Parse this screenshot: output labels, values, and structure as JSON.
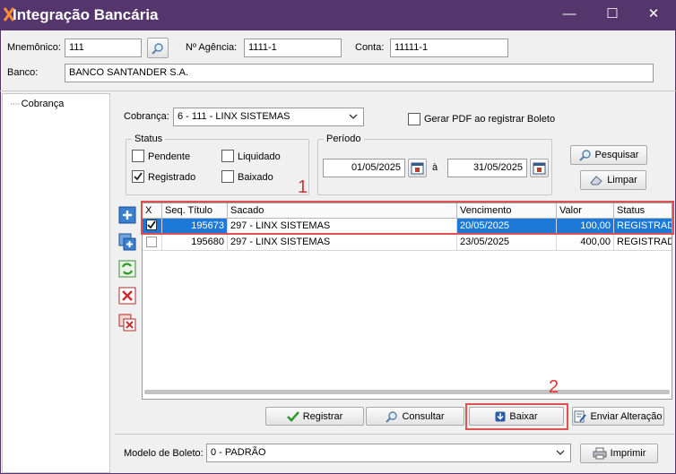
{
  "window": {
    "title": "Integração Bancária",
    "minimize_icon": "minimize-icon",
    "maximize_icon": "maximize-icon",
    "close_icon": "close-icon"
  },
  "header_fields": {
    "mnemonico_label": "Mnemônico:",
    "mnemonico_value": "111",
    "agencia_label": "Nº Agência:",
    "agencia_value": "1111-1",
    "conta_label": "Conta:",
    "conta_value": "11111-1",
    "banco_label": "Banco:",
    "banco_value": "BANCO SANTANDER S.A."
  },
  "tree": {
    "items": [
      {
        "label": "Cobrança"
      }
    ]
  },
  "filters": {
    "cobranca_label": "Cobrança:",
    "cobranca_value": "6 - 111 - LINX SISTEMAS",
    "gerar_pdf_label": "Gerar PDF ao registrar Boleto",
    "gerar_pdf_checked": false,
    "status_group_label": "Status",
    "status_options": [
      {
        "label": "Pendente",
        "checked": false
      },
      {
        "label": "Liquidado",
        "checked": false
      },
      {
        "label": "Registrado",
        "checked": true
      },
      {
        "label": "Baixado",
        "checked": false
      }
    ],
    "periodo_group_label": "Período",
    "periodo_from": "01/05/2025",
    "periodo_sep": "à",
    "periodo_to": "31/05/2025",
    "pesquisar_label": "Pesquisar",
    "limpar_label": "Limpar"
  },
  "grid": {
    "columns": [
      "X",
      "Seq. Título",
      "Sacado",
      "Vencimento",
      "Valor",
      "Status"
    ],
    "rows": [
      {
        "checked": true,
        "seq": "195673",
        "sacado": "297 - LINX SISTEMAS",
        "vencimento": "20/05/2025",
        "valor": "100,00",
        "status": "REGISTRADO",
        "selected": true
      },
      {
        "checked": false,
        "seq": "195680",
        "sacado": "297 - LINX SISTEMAS",
        "vencimento": "23/05/2025",
        "valor": "400,00",
        "status": "REGISTRADO",
        "selected": false
      }
    ]
  },
  "annotations": {
    "one": "1",
    "two": "2"
  },
  "actions": {
    "registrar": "Registrar",
    "consultar": "Consultar",
    "baixar": "Baixar",
    "enviar": "Enviar Alteração"
  },
  "footer": {
    "modelo_label": "Modelo de Boleto:",
    "modelo_value": "0 - PADRÃO",
    "imprimir": "Imprimir"
  },
  "colors": {
    "titlebar": "#54366d",
    "selection": "#1c79d7",
    "annotation": "#e03030"
  }
}
